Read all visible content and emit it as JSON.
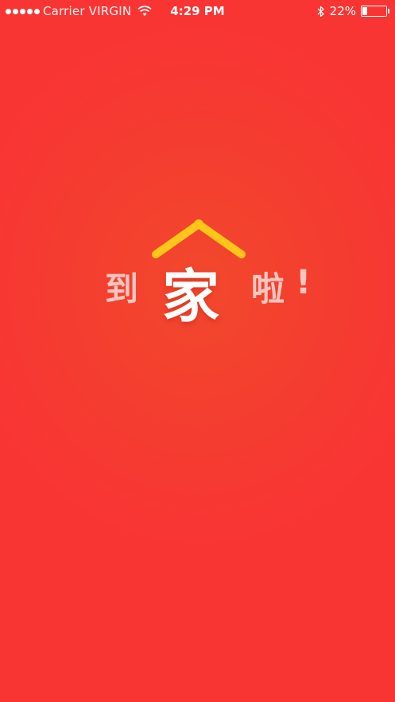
{
  "status_bar": {
    "carrier": "Carrier VIRGIN",
    "time": "4:29 PM",
    "battery_percent": "22%",
    "battery_level": 0.22
  },
  "splash": {
    "char_1": "到",
    "char_2": "家",
    "char_3": "啦",
    "char_4": "!",
    "roof_color": "#ffc61a",
    "background_color": "#f93534"
  }
}
